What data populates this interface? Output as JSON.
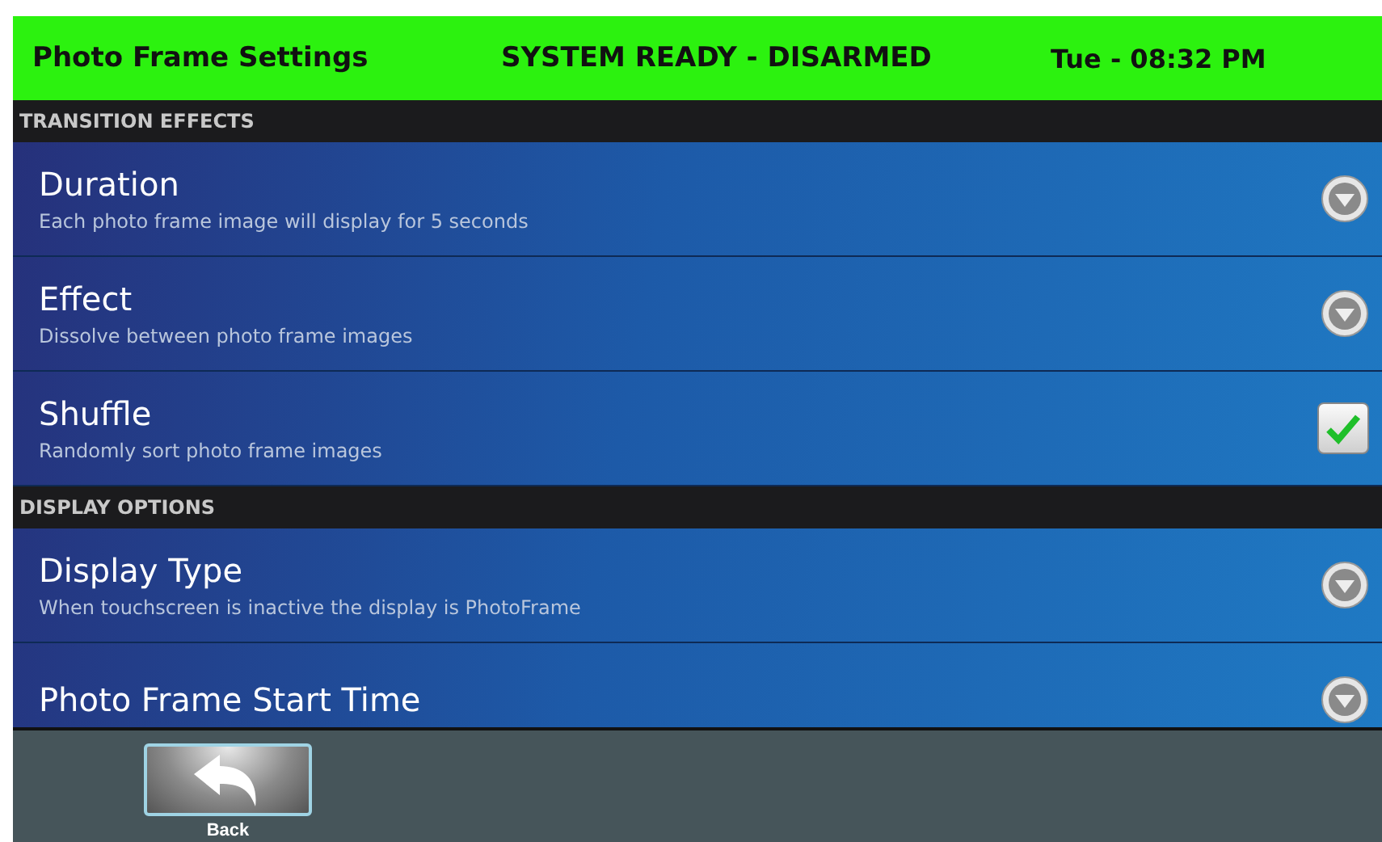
{
  "header": {
    "title": "Photo Frame Settings",
    "status": "SYSTEM READY - DISARMED",
    "clock": "Tue - 08:32 PM"
  },
  "sections": [
    {
      "title": "TRANSITION EFFECTS",
      "items": [
        {
          "label": "Duration",
          "summary": "Each photo frame image will display for 5 seconds",
          "kind": "dropdown"
        },
        {
          "label": "Effect",
          "summary": "Dissolve between photo frame images",
          "kind": "dropdown"
        },
        {
          "label": "Shuffle",
          "summary": "Randomly sort photo frame images",
          "kind": "checkbox",
          "checked": true
        }
      ]
    },
    {
      "title": "DISPLAY OPTIONS",
      "items": [
        {
          "label": "Display Type",
          "summary": "When touchscreen is inactive the display is PhotoFrame",
          "kind": "dropdown"
        },
        {
          "label": "Photo Frame Start Time",
          "kind": "dropdown"
        }
      ]
    }
  ],
  "footer": {
    "back_label": "Back"
  }
}
